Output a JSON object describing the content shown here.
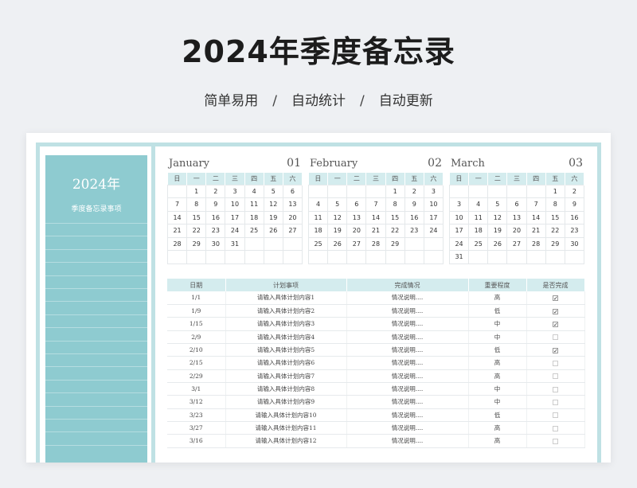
{
  "header": {
    "title": "2024年季度备忘录",
    "subtitle": [
      "简单易用",
      "自动统计",
      "自动更新"
    ],
    "separator": "/"
  },
  "sidebar": {
    "year": "2024年",
    "label": "季度备忘录事项"
  },
  "weekdays": [
    "日",
    "一",
    "二",
    "三",
    "四",
    "五",
    "六"
  ],
  "months": [
    {
      "name": "January",
      "number": "01",
      "weeks": [
        [
          "",
          "1",
          "2",
          "3",
          "4",
          "5",
          "6"
        ],
        [
          "7",
          "8",
          "9",
          "10",
          "11",
          "12",
          "13"
        ],
        [
          "14",
          "15",
          "16",
          "17",
          "18",
          "19",
          "20"
        ],
        [
          "21",
          "22",
          "23",
          "24",
          "25",
          "26",
          "27"
        ],
        [
          "28",
          "29",
          "30",
          "31",
          "",
          "",
          ""
        ],
        [
          "",
          "",
          "",
          "",
          "",
          "",
          ""
        ]
      ]
    },
    {
      "name": "February",
      "number": "02",
      "weeks": [
        [
          "",
          "",
          "",
          "",
          "1",
          "2",
          "3"
        ],
        [
          "4",
          "5",
          "6",
          "7",
          "8",
          "9",
          "10"
        ],
        [
          "11",
          "12",
          "13",
          "14",
          "15",
          "16",
          "17"
        ],
        [
          "18",
          "19",
          "20",
          "21",
          "22",
          "23",
          "24"
        ],
        [
          "25",
          "26",
          "27",
          "28",
          "29",
          "",
          ""
        ],
        [
          "",
          "",
          "",
          "",
          "",
          "",
          ""
        ]
      ]
    },
    {
      "name": "March",
      "number": "03",
      "weeks": [
        [
          "",
          "",
          "",
          "",
          "",
          "1",
          "2"
        ],
        [
          "3",
          "4",
          "5",
          "6",
          "7",
          "8",
          "9"
        ],
        [
          "10",
          "11",
          "12",
          "13",
          "14",
          "15",
          "16"
        ],
        [
          "17",
          "18",
          "19",
          "20",
          "21",
          "22",
          "23"
        ],
        [
          "24",
          "25",
          "26",
          "27",
          "28",
          "29",
          "30"
        ],
        [
          "31",
          "",
          "",
          "",
          "",
          "",
          ""
        ]
      ]
    }
  ],
  "table": {
    "headers": [
      "日期",
      "计划事项",
      "完成情况",
      "重要程度",
      "是否完成"
    ],
    "rows": [
      {
        "date": "1/1",
        "item": "请输入具体计划内容1",
        "status": "情况说明....",
        "priority": "高",
        "done": true
      },
      {
        "date": "1/9",
        "item": "请输入具体计划内容2",
        "status": "情况说明....",
        "priority": "低",
        "done": true
      },
      {
        "date": "1/15",
        "item": "请输入具体计划内容3",
        "status": "情况说明....",
        "priority": "中",
        "done": true
      },
      {
        "date": "2/9",
        "item": "请输入具体计划内容4",
        "status": "情况说明....",
        "priority": "中",
        "done": false
      },
      {
        "date": "2/10",
        "item": "请输入具体计划内容5",
        "status": "情况说明....",
        "priority": "低",
        "done": true
      },
      {
        "date": "2/15",
        "item": "请输入具体计划内容6",
        "status": "情况说明....",
        "priority": "高",
        "done": false
      },
      {
        "date": "2/29",
        "item": "请输入具体计划内容7",
        "status": "情况说明....",
        "priority": "高",
        "done": false
      },
      {
        "date": "3/1",
        "item": "请输入具体计划内容8",
        "status": "情况说明....",
        "priority": "中",
        "done": false
      },
      {
        "date": "3/12",
        "item": "请输入具体计划内容9",
        "status": "情况说明....",
        "priority": "中",
        "done": false
      },
      {
        "date": "3/23",
        "item": "请输入具体计划内容10",
        "status": "情况说明....",
        "priority": "低",
        "done": false
      },
      {
        "date": "3/27",
        "item": "请输入具体计划内容11",
        "status": "情况说明....",
        "priority": "高",
        "done": false
      },
      {
        "date": "3/16",
        "item": "请输入具体计划内容12",
        "status": "情况说明....",
        "priority": "高",
        "done": false
      }
    ]
  },
  "colors": {
    "accent": "#8ecbd0",
    "header_fill": "#d4ecee",
    "frame": "#bfe1e4"
  }
}
